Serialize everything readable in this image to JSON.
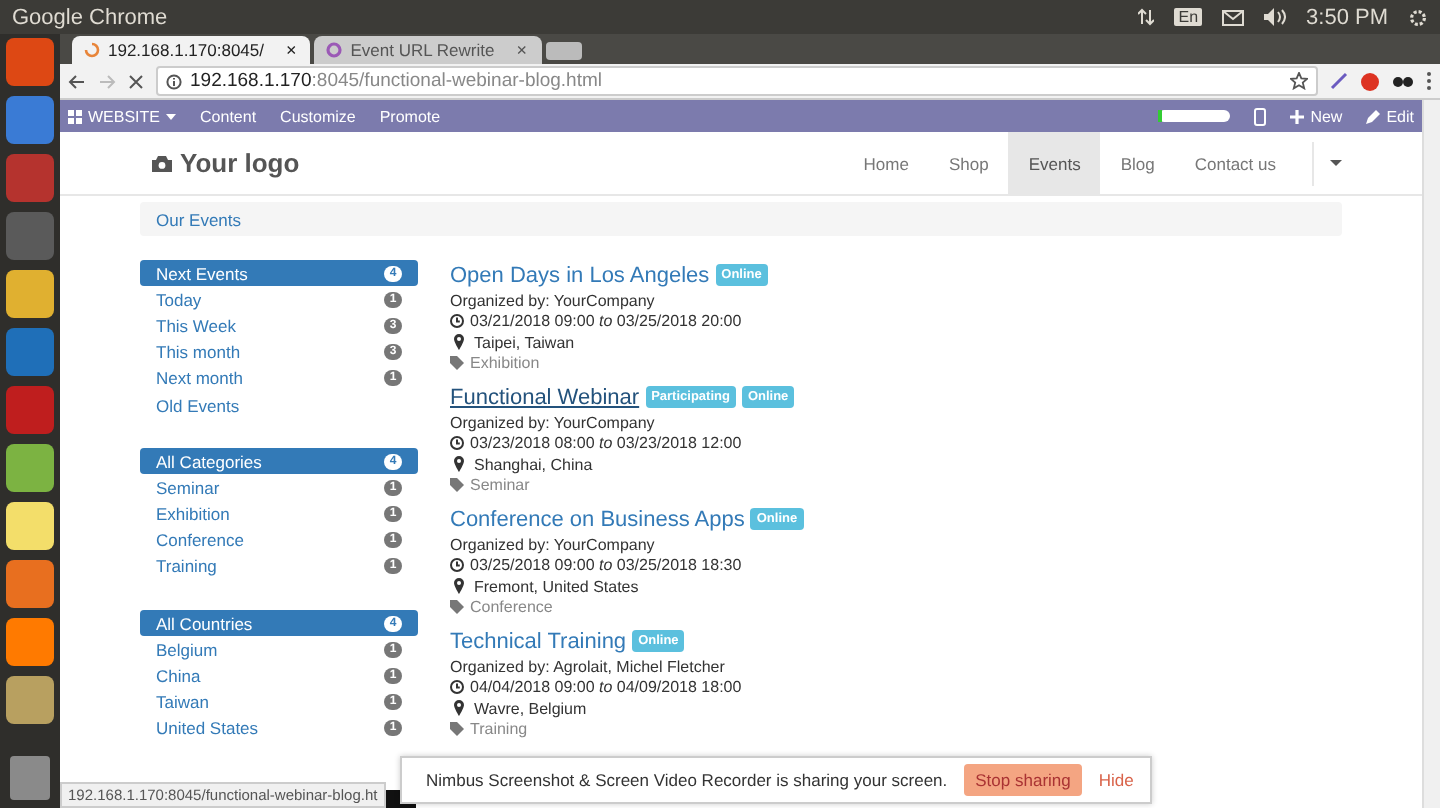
{
  "desktop": {
    "app_name": "Google Chrome",
    "clock": "3:50 PM",
    "keyboard": "En"
  },
  "browser": {
    "tabs": [
      {
        "title": "192.168.1.170:8045/",
        "selected": true,
        "loading": true,
        "close": "×"
      },
      {
        "title": "Event URL Rewrite",
        "selected": false,
        "loading": false,
        "close": "×"
      }
    ],
    "url_host": "192.168.1.170",
    "url_path": ":8045/functional-webinar-blog.html"
  },
  "odoo_bar": {
    "app_menu": "WEBSITE",
    "menu": [
      "Content",
      "Customize",
      "Promote"
    ],
    "new_label": "New",
    "edit_label": "Edit"
  },
  "site": {
    "logo": "Your logo",
    "nav": [
      {
        "label": "Home",
        "selected": false
      },
      {
        "label": "Shop",
        "selected": false
      },
      {
        "label": "Events",
        "selected": true
      },
      {
        "label": "Blog",
        "selected": false
      },
      {
        "label": "Contact us",
        "selected": false
      }
    ],
    "breadcrumb": "Our Events",
    "filters": [
      {
        "items": [
          {
            "label": "Next Events",
            "count": "4",
            "selected": true
          },
          {
            "label": "Today",
            "count": "1",
            "selected": false
          },
          {
            "label": "This Week",
            "count": "3",
            "selected": false
          },
          {
            "label": "This month",
            "count": "3",
            "selected": false
          },
          {
            "label": "Next month",
            "count": "1",
            "selected": false
          },
          {
            "label": "Old Events",
            "selected": false
          }
        ]
      },
      {
        "items": [
          {
            "label": "All Categories",
            "count": "4",
            "selected": true
          },
          {
            "label": "Seminar",
            "count": "1",
            "selected": false
          },
          {
            "label": "Exhibition",
            "count": "1",
            "selected": false
          },
          {
            "label": "Conference",
            "count": "1",
            "selected": false
          },
          {
            "label": "Training",
            "count": "1",
            "selected": false
          }
        ]
      },
      {
        "items": [
          {
            "label": "All Countries",
            "count": "4",
            "selected": true
          },
          {
            "label": "Belgium",
            "count": "1",
            "selected": false
          },
          {
            "label": "China",
            "count": "1",
            "selected": false
          },
          {
            "label": "Taiwan",
            "count": "1",
            "selected": false
          },
          {
            "label": "United States",
            "count": "1",
            "selected": false
          }
        ]
      }
    ],
    "events": [
      {
        "title": "Open Days in Los Angeles",
        "hovered": false,
        "badges": [
          "Online"
        ],
        "organizer": "Organized by: YourCompany",
        "dates": "03/21/2018 09:00 *to* 03/25/2018 20:00",
        "location": "Taipei, Taiwan",
        "tag": "Exhibition"
      },
      {
        "title": "Functional Webinar",
        "hovered": true,
        "badges": [
          "Participating",
          "Online"
        ],
        "organizer": "Organized by: YourCompany",
        "dates": "03/23/2018 08:00 *to* 03/23/2018 12:00",
        "location": "Shanghai, China",
        "tag": "Seminar"
      },
      {
        "title": "Conference on Business Apps",
        "hovered": false,
        "badges": [
          "Online"
        ],
        "organizer": "Organized by: YourCompany",
        "dates": "03/25/2018 09:00 *to* 03/25/2018 18:30",
        "location": "Fremont, United States",
        "tag": "Conference"
      },
      {
        "title": "Technical Training",
        "hovered": false,
        "badges": [
          "Online"
        ],
        "organizer": "Organized by: Agrolait, Michel Fletcher",
        "dates": "04/04/2018 09:00 *to* 04/09/2018 18:00",
        "location": "Wavre, Belgium",
        "tag": "Training"
      }
    ]
  },
  "status_url": "192.168.1.170:8045/functional-webinar-blog.ht",
  "sharing_bar": {
    "message": "Nimbus Screenshot & Screen Video Recorder is sharing your screen.",
    "stop": "Stop sharing",
    "hide": "Hide"
  }
}
